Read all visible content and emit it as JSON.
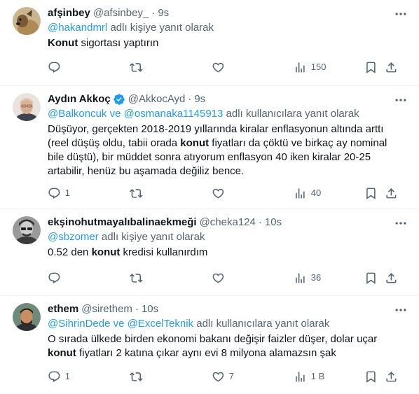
{
  "tweets": [
    {
      "name": "afşinbey",
      "handle": "@afsinbey_",
      "time": "9s",
      "verified": false,
      "reply_prefix": "",
      "reply_mentions": [
        "@hakandmrl"
      ],
      "reply_joiner": "",
      "reply_suffix": "adlı kişiye yanıt olarak",
      "body_parts": [
        {
          "bold": true,
          "text": "Konut"
        },
        {
          "bold": false,
          "text": " sigortası yaptırın"
        }
      ],
      "stats": {
        "replies": "",
        "retweets": "",
        "likes": "",
        "views": "150"
      }
    },
    {
      "name": "Aydın Akkoç",
      "handle": "@AkkocAyd",
      "time": "9s",
      "verified": true,
      "reply_mentions": [
        "@Balkoncuk",
        "@osmanaka1145913"
      ],
      "reply_joiner": "ve",
      "reply_suffix": "adlı kullanıcılara yanıt olarak",
      "body_parts": [
        {
          "bold": false,
          "text": "Düşüyor, gerçekten 2018-2019 yıllarında kiralar enflasyonun altında arttı (reel düşüş oldu, tabii orada "
        },
        {
          "bold": true,
          "text": "konut"
        },
        {
          "bold": false,
          "text": " fiyatları da çöktü ve birkaç ay nominal bile düştü), bir müddet sonra atıyorum enflasyon 40 iken kiralar 20-25 artabilir, henüz bu aşamada değiliz bence."
        }
      ],
      "stats": {
        "replies": "1",
        "retweets": "",
        "likes": "",
        "views": "40"
      }
    },
    {
      "name": "ekşinohutmayalıbalinaekmeği",
      "handle": "@cheka124",
      "time": "10s",
      "verified": false,
      "reply_mentions": [
        "@sbzomer"
      ],
      "reply_joiner": "",
      "reply_suffix": "adlı kişiye yanıt olarak",
      "body_parts": [
        {
          "bold": false,
          "text": "0.52 den "
        },
        {
          "bold": true,
          "text": "konut"
        },
        {
          "bold": false,
          "text": " kredisi kullanırdım"
        }
      ],
      "stats": {
        "replies": "",
        "retweets": "",
        "likes": "",
        "views": "36"
      }
    },
    {
      "name": "ethem",
      "handle": "@sirethem",
      "time": "10s",
      "verified": false,
      "reply_mentions": [
        "@SihrinDede",
        "@ExcelTeknik"
      ],
      "reply_joiner": "ve",
      "reply_suffix": "adlı kullanıcılara yanıt olarak",
      "body_parts": [
        {
          "bold": false,
          "text": "O sırada ülkede birden ekonomi bakanı değişir faizler düşer, dolar uçar "
        },
        {
          "bold": true,
          "text": "konut"
        },
        {
          "bold": false,
          "text": " fiyatları 2 katına çıkar aynı evi 8 milyona alamazsın şak"
        }
      ],
      "stats": {
        "replies": "1",
        "retweets": "",
        "likes": "7",
        "views": "1 B"
      }
    }
  ],
  "colors": {
    "link": "#1d9bf0",
    "muted": "#536471",
    "text": "#0f1419",
    "border": "#eff3f4"
  },
  "icons": [
    "more-icon",
    "reply-icon",
    "retweet-icon",
    "like-icon",
    "views-icon",
    "bookmark-icon",
    "share-icon",
    "verified-badge-icon"
  ]
}
